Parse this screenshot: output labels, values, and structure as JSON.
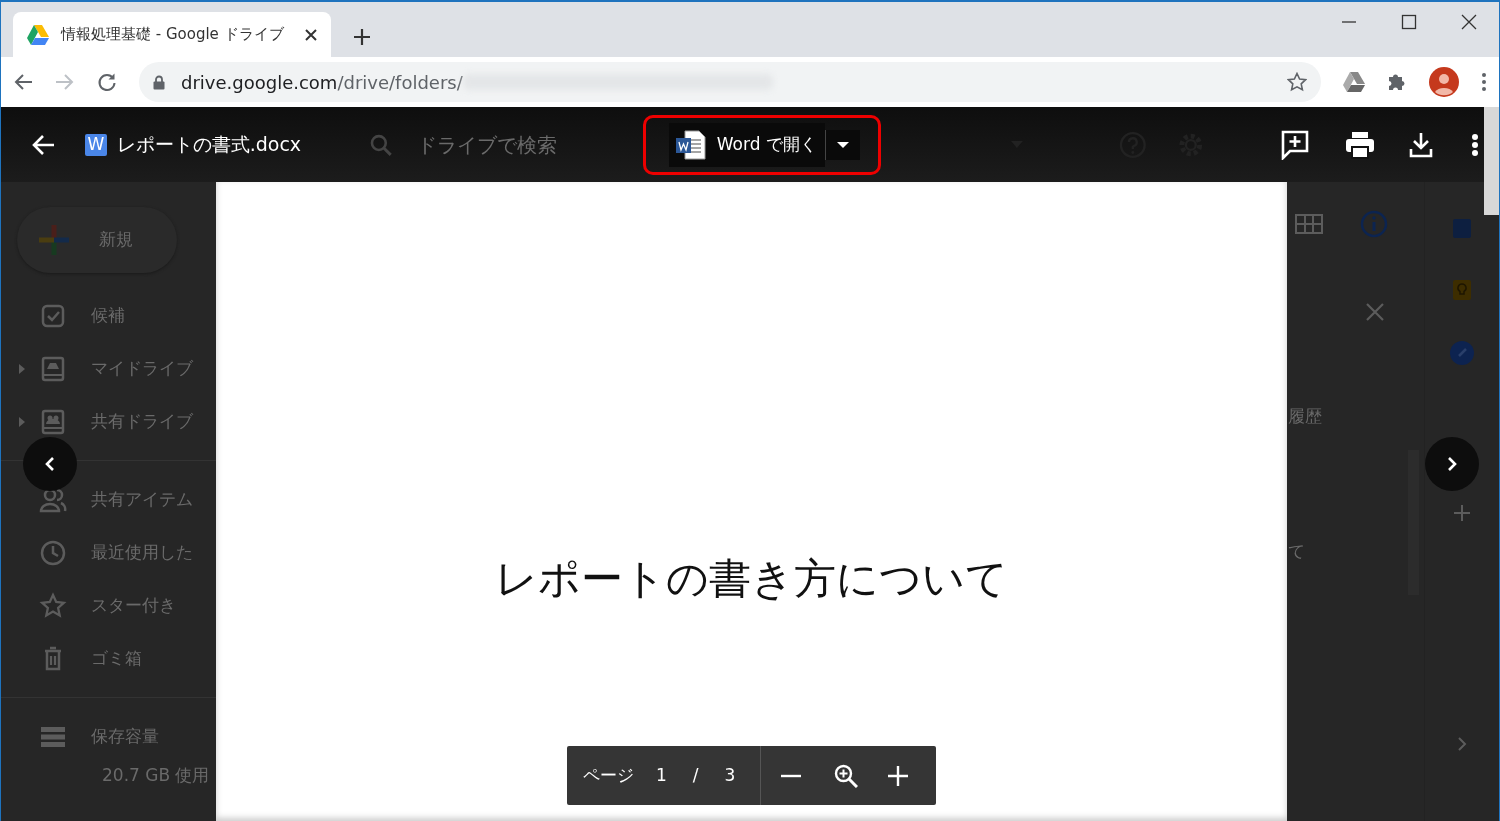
{
  "browser": {
    "tab_title": "情報処理基礎 - Google ドライブ",
    "url_host": "drive.google.com",
    "url_path": "/drive/folders/"
  },
  "background": {
    "new_button": "新規",
    "search_placeholder": "ドライブで検索",
    "sidebar": [
      {
        "kind": "check",
        "label": "候補",
        "expandable": false,
        "divider_before": false
      },
      {
        "kind": "drive",
        "label": "マイドライブ",
        "expandable": true,
        "divider_before": false
      },
      {
        "kind": "shared-drive",
        "label": "共有ドライブ",
        "expandable": true,
        "divider_before": false
      },
      {
        "kind": "people",
        "label": "共有アイテム",
        "expandable": false,
        "divider_before": true
      },
      {
        "kind": "clock",
        "label": "最近使用した",
        "expandable": false,
        "divider_before": false
      },
      {
        "kind": "star",
        "label": "スター付き",
        "expandable": false,
        "divider_before": false
      },
      {
        "kind": "trash",
        "label": "ゴミ箱",
        "expandable": false,
        "divider_before": false
      }
    ],
    "storage": {
      "label": "保存容量",
      "usage": "20.7 GB 使用"
    },
    "panel_texts": [
      "履歴",
      "て"
    ]
  },
  "viewer": {
    "file_type_badge": "W",
    "file_name": "レポートの書式.docx",
    "open_button": "Word で開く",
    "open_button_highlighted": true
  },
  "document": {
    "title": "レポートの書き方について"
  },
  "page_controls": {
    "label": "ページ",
    "current": "1",
    "separator": "/",
    "total": "3"
  }
}
